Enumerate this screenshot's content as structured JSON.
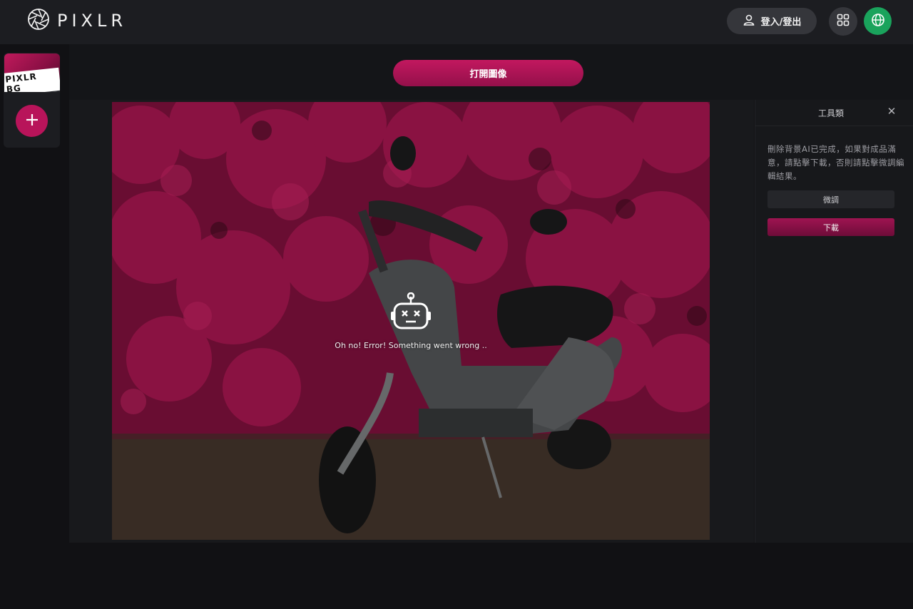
{
  "header": {
    "logo_text": "PIXLR",
    "login_label": "登入/登出"
  },
  "sidebar": {
    "thumbnail_label": "PIXLR BG"
  },
  "toolbar": {
    "open_image_label": "打開圖像"
  },
  "canvas": {
    "error_message": "Oh no! Error! Something went wrong .."
  },
  "tools_panel": {
    "title": "工具類",
    "description": "刪除背景AI已完成，如果對成品滿意，請點擊下載，否則請點擊微調編輯結果。",
    "fine_tune_label": "微調",
    "download_label": "下載"
  },
  "colors": {
    "accent": "#b8145a",
    "globe": "#1aa35c"
  }
}
